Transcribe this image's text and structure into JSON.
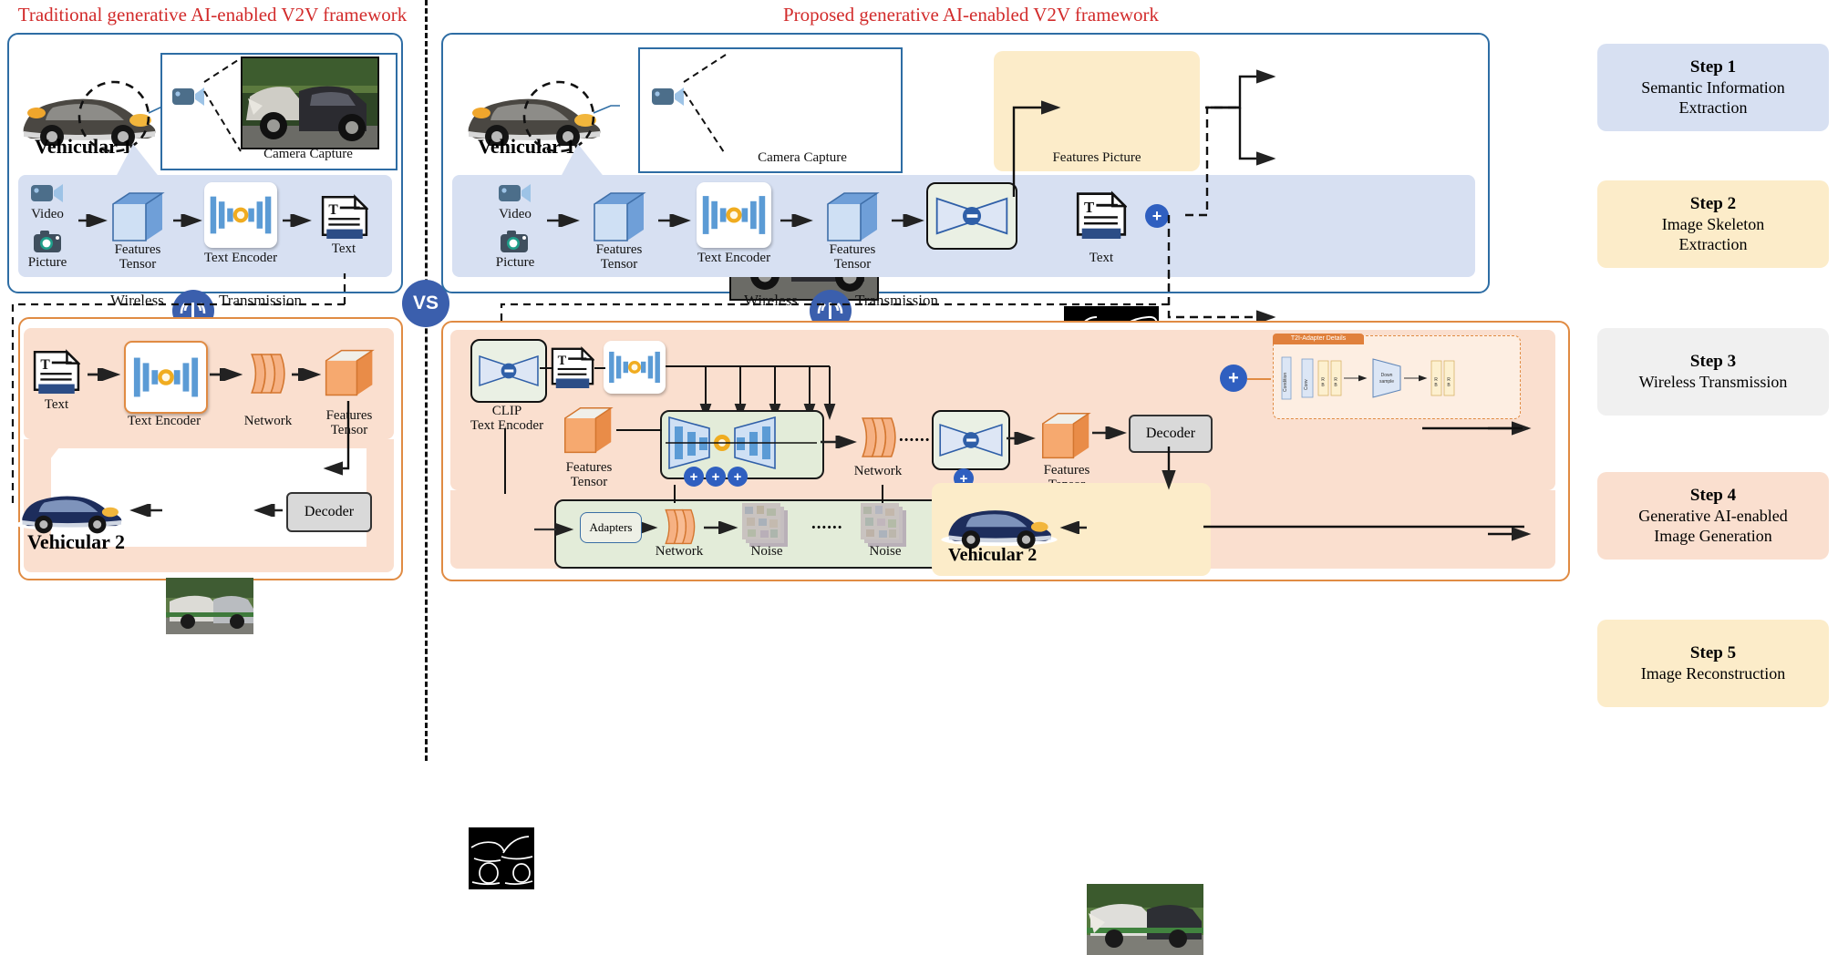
{
  "titles": {
    "left": "Traditional generative AI-enabled V2V framework",
    "right": "Proposed generative AI-enabled V2V framework",
    "vs": "VS"
  },
  "left_panel": {
    "vehicle_label": "Vehicular 1",
    "camera_capture_label": "Camera Capture",
    "pipeline": {
      "input_video": "Video",
      "input_picture": "Picture",
      "features_tensor": "Features\nTensor",
      "text_encoder": "Text Encoder",
      "text": "Text"
    },
    "wireless": {
      "left_word": "Wireless",
      "right_word": "Transmission",
      "icon": "wifi-icon"
    },
    "receiver": {
      "text": "Text",
      "text_encoder": "Text Encoder",
      "network": "Network",
      "features_tensor": "Features\nTensor",
      "decoder": "Decoder",
      "vehicle_label": "Vehicular 2"
    }
  },
  "right_panel": {
    "vehicle_label": "Vehicular 1",
    "camera_capture_label": "Camera Capture",
    "features_picture_label": "Features Picture",
    "pipeline": {
      "input_video": "Video",
      "input_picture": "Picture",
      "features_tensor_1": "Features\nTensor",
      "text_encoder": "Text Encoder",
      "features_tensor_2": "Features\nTensor",
      "text": "Text",
      "plus": "+"
    },
    "wireless": {
      "left_word": "Wireless",
      "right_word": "Transmission",
      "icon": "wifi-icon"
    },
    "generation": {
      "clip_text_encoder": "CLIP\nText Encoder",
      "features_tensor_in": "Features\nTensor",
      "network": "Network",
      "features_tensor_out": "Features\nTensor",
      "decoder": "Decoder",
      "vehicle_label": "Vehicular 2",
      "plus_signs": [
        "+",
        "+",
        "+",
        "+"
      ],
      "unet_dots": "......",
      "adapters": "Adapters",
      "adapter_network": "Network",
      "noise_first": "Noise",
      "noise_last": "Noise",
      "noise_dots": "......",
      "t2i_title": "T2I-Adapter Details",
      "t2i_plus": "+",
      "t2i_labels": [
        "Condition",
        "Conv",
        "R\nB",
        "R\nB",
        "Down\nsample",
        "R\nB",
        "R\nB"
      ]
    }
  },
  "steps": [
    {
      "num": "Step 1",
      "text": "Semantic Information\nExtraction",
      "color": "#d7e0f2"
    },
    {
      "num": "Step 2",
      "text": "Image Skeleton\nExtraction",
      "color": "#fcecc9"
    },
    {
      "num": "Step 3",
      "text": "Wireless Transmission",
      "color": "#f0f0f0"
    },
    {
      "num": "Step 4",
      "text": "Generative AI-enabled\nImage Generation",
      "color": "#fadfcf"
    },
    {
      "num": "Step 5",
      "text": "Image Reconstruction",
      "color": "#fcecc9"
    }
  ],
  "colors": {
    "title_red": "#d22b2b",
    "panel_blue": "#2e6da4",
    "panel_orange": "#e08b43",
    "band_blue": "#d7e0f2",
    "band_orange": "#fadfcf",
    "accent_blue": "#3b5fad",
    "tensor_blue": "#5b9bd5",
    "tensor_orange": "#f4a26a"
  }
}
